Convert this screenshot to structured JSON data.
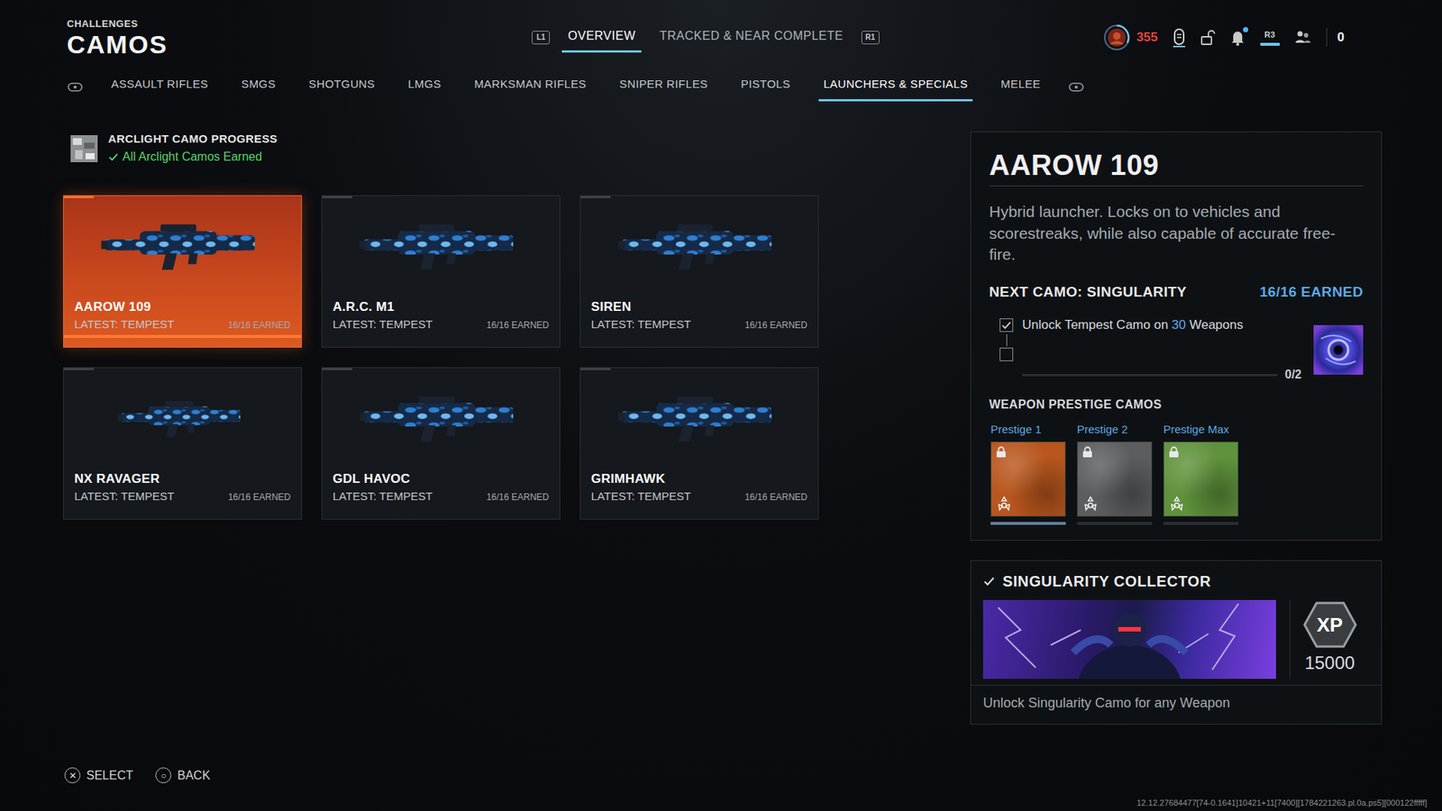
{
  "header": {
    "overline": "CHALLENGES",
    "title": "CAMOS"
  },
  "top_tabs": {
    "prev_key": "L1",
    "next_key": "R1",
    "items": [
      {
        "label": "OVERVIEW",
        "selected": true
      },
      {
        "label": "TRACKED & NEAR COMPLETE",
        "selected": false
      }
    ]
  },
  "status": {
    "currency": "355",
    "notification": true,
    "key": "R3",
    "count": "0"
  },
  "categories": [
    {
      "label": "ASSAULT RIFLES",
      "selected": false
    },
    {
      "label": "SMGS",
      "selected": false
    },
    {
      "label": "SHOTGUNS",
      "selected": false
    },
    {
      "label": "LMGS",
      "selected": false
    },
    {
      "label": "MARKSMAN RIFLES",
      "selected": false
    },
    {
      "label": "SNIPER RIFLES",
      "selected": false
    },
    {
      "label": "PISTOLS",
      "selected": false
    },
    {
      "label": "LAUNCHERS & SPECIALS",
      "selected": true
    },
    {
      "label": "MELEE",
      "selected": false
    }
  ],
  "progress": {
    "title": "ARCLIGHT CAMO PROGRESS",
    "completed": true,
    "status": "All Arclight Camos Earned"
  },
  "weapons": [
    {
      "name": "AAROW 109",
      "latest": "LATEST: TEMPEST",
      "earned": "16/16 EARNED",
      "selected": true
    },
    {
      "name": "A.R.C. M1",
      "latest": "LATEST: TEMPEST",
      "earned": "16/16 EARNED",
      "selected": false
    },
    {
      "name": "SIREN",
      "latest": "LATEST: TEMPEST",
      "earned": "16/16 EARNED",
      "selected": false
    },
    {
      "name": "NX RAVAGER",
      "latest": "LATEST: TEMPEST",
      "earned": "16/16 EARNED",
      "selected": false
    },
    {
      "name": "GDL HAVOC",
      "latest": "LATEST: TEMPEST",
      "earned": "16/16 EARNED",
      "selected": false
    },
    {
      "name": "GRIMHAWK",
      "latest": "LATEST: TEMPEST",
      "earned": "16/16 EARNED",
      "selected": false
    }
  ],
  "detail": {
    "title": "AAROW 109",
    "description": "Hybrid launcher. Locks on to vehicles and scorestreaks, while also capable of accurate free-fire.",
    "next_label": "NEXT CAMO: SINGULARITY",
    "next_earned": "16/16 EARNED",
    "requirements": [
      {
        "before": "Unlock Tempest Camo on ",
        "count": "30",
        "after": " Weapons",
        "checked": true
      },
      {
        "checked": false
      }
    ],
    "requirements_progress": "0/2",
    "requirements_level": 0,
    "prestige_title": "WEAPON PRESTIGE CAMOS",
    "prestige": [
      {
        "label": "Prestige 1",
        "locked": true,
        "level": 1,
        "color": "#b8561d"
      },
      {
        "label": "Prestige 2",
        "locked": true,
        "level": 0,
        "color": "#5c5d5e"
      },
      {
        "label": "Prestige Max",
        "locked": true,
        "level": 0,
        "color": "#5f923b"
      }
    ]
  },
  "collector": {
    "completed": true,
    "title": "SINGULARITY COLLECTOR",
    "xp_label": "XP",
    "xp": "15000",
    "description": "Unlock Singularity Camo for any Weapon"
  },
  "footer": {
    "actions": [
      {
        "key": "✕",
        "label": "SELECT"
      },
      {
        "key": "○",
        "label": "BACK"
      }
    ],
    "build": "12.12.27684477[74-0.1641]10421+11[7400][1784221263.pl.0a.ps5][000122fffff]"
  }
}
